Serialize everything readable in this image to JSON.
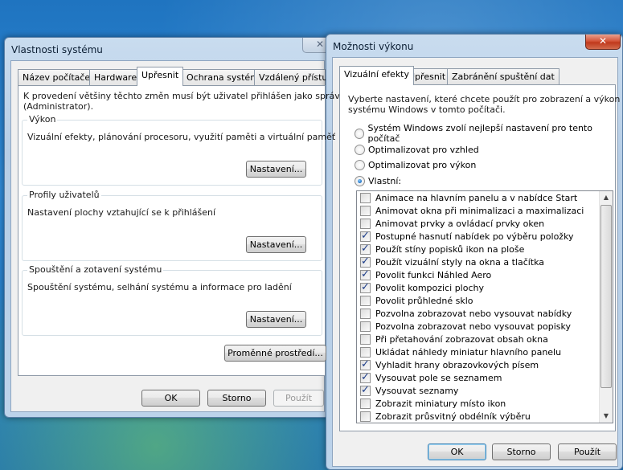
{
  "system_properties": {
    "title": "Vlastnosti systému",
    "close_glyph": "✕",
    "tabs": [
      {
        "label": "Název počítače"
      },
      {
        "label": "Hardware"
      },
      {
        "label": "Upřesnit",
        "active": true
      },
      {
        "label": "Ochrana systému"
      },
      {
        "label": "Vzdálený přístup"
      }
    ],
    "admin_note": "K provedení většiny těchto změn musí být uživatel přihlášen jako správce",
    "admin_note2": "(Administrator).",
    "groups": {
      "performance": {
        "title": "Výkon",
        "desc": "Vizuální efekty, plánování procesoru, využití paměti a virtuální paměť",
        "button": "Nastavení..."
      },
      "profiles": {
        "title": "Profily uživatelů",
        "desc": "Nastavení plochy vztahující se k přihlášení",
        "button": "Nastavení..."
      },
      "startup": {
        "title": "Spouštění a zotavení systému",
        "desc": "Spouštění systému, selhání systému a informace pro ladění",
        "button": "Nastavení..."
      }
    },
    "env_button": "Proměnné prostředí...",
    "ok": "OK",
    "cancel": "Storno",
    "apply": "Použít"
  },
  "performance_options": {
    "title": "Možnosti výkonu",
    "close_glyph": "✕",
    "tabs": [
      {
        "label": "Vizuální efekty",
        "active": true
      },
      {
        "label": "Upřesnit"
      },
      {
        "label": "Zabránění spuštění dat"
      }
    ],
    "intro": "Vyberte nastavení, které chcete použít pro zobrazení a výkon",
    "intro2": "systému Windows v tomto počítači.",
    "radios": [
      {
        "label": "Systém Windows zvolí nejlepší nastavení pro tento počítač",
        "checked": false
      },
      {
        "label": "Optimalizovat pro vzhled",
        "checked": false
      },
      {
        "label": "Optimalizovat pro výkon",
        "checked": false
      },
      {
        "label": "Vlastní:",
        "checked": true
      }
    ],
    "effects": [
      {
        "label": "Animace na hlavním panelu a v nabídce Start",
        "checked": false
      },
      {
        "label": "Animovat okna při minimalizaci a maximalizaci",
        "checked": false
      },
      {
        "label": "Animovat prvky a ovládací prvky oken",
        "checked": false
      },
      {
        "label": "Postupné hasnutí nabídek po výběru položky",
        "checked": true
      },
      {
        "label": "Použít stíny popisků ikon na ploše",
        "checked": true
      },
      {
        "label": "Použít vizuální styly na okna a tlačítka",
        "checked": true
      },
      {
        "label": "Povolit funkci Náhled Aero",
        "checked": true
      },
      {
        "label": "Povolit kompozici plochy",
        "checked": true
      },
      {
        "label": "Povolit průhledné sklo",
        "checked": false
      },
      {
        "label": "Pozvolna zobrazovat nebo vysouvat nabídky",
        "checked": false
      },
      {
        "label": "Pozvolna zobrazovat nebo vysouvat popisky",
        "checked": false
      },
      {
        "label": "Při přetahování zobrazovat obsah okna",
        "checked": false
      },
      {
        "label": "Ukládat náhledy miniatur hlavního panelu",
        "checked": false
      },
      {
        "label": "Vyhladit hrany obrazovkových písem",
        "checked": true
      },
      {
        "label": "Vysouvat pole se seznamem",
        "checked": true
      },
      {
        "label": "Vysouvat seznamy",
        "checked": true
      },
      {
        "label": "Zobrazit miniatury místo ikon",
        "checked": false
      },
      {
        "label": "Zobrazit průsvitný obdélník výběru",
        "checked": false
      }
    ],
    "ok": "OK",
    "cancel": "Storno",
    "apply": "Použít"
  }
}
